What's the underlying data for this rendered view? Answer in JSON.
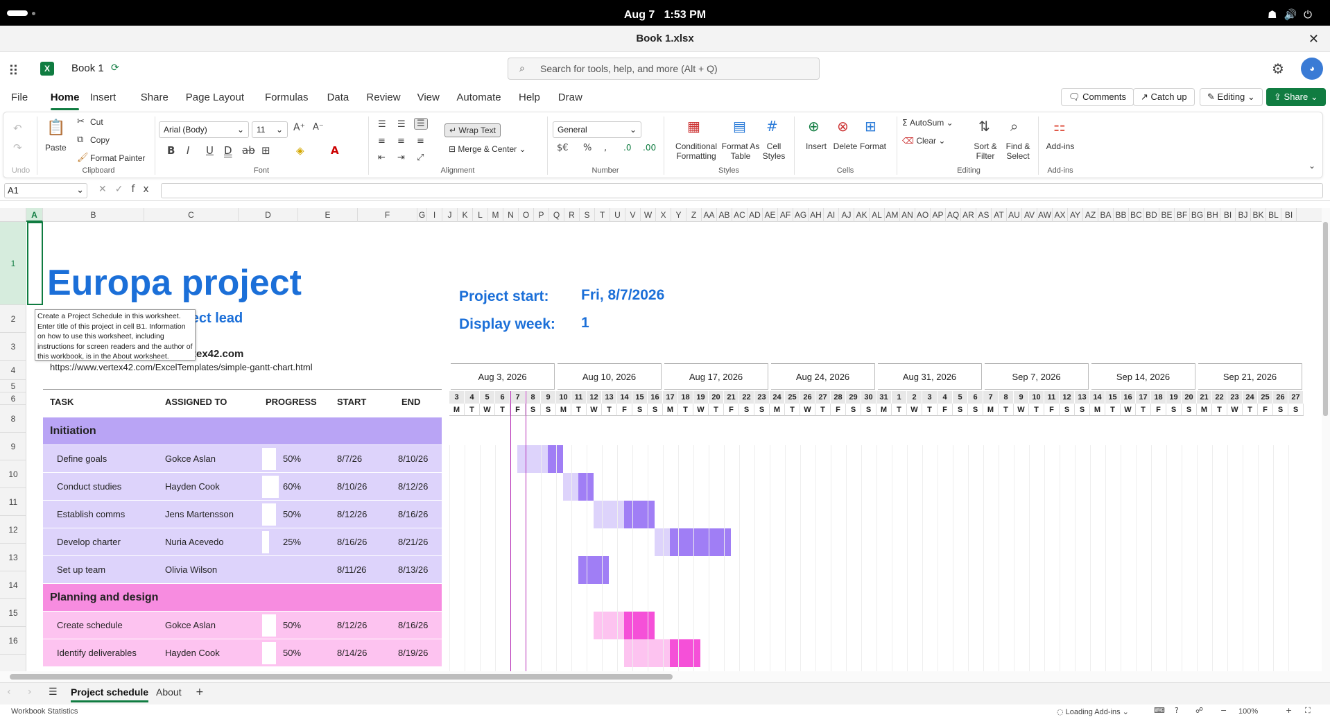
{
  "system": {
    "date": "Aug 7",
    "time": "1:53 PM"
  },
  "window": {
    "title": "Book 1.xlsx"
  },
  "appbar": {
    "book_name": "Book 1",
    "search_placeholder": "Search for tools, help, and more (Alt + Q)"
  },
  "menu": [
    "File",
    "Home",
    "Insert",
    "Share",
    "Page Layout",
    "Formulas",
    "Data",
    "Review",
    "View",
    "Automate",
    "Help",
    "Draw"
  ],
  "menu_active": "Home",
  "actions": {
    "comments": "Comments",
    "catchup": "Catch up",
    "editing": "Editing",
    "share": "Share"
  },
  "ribbon": {
    "undo": "Undo",
    "paste": "Paste",
    "cut": "Cut",
    "copy": "Copy",
    "format_painter": "Format Painter",
    "clipboard": "Clipboard",
    "font_name": "Arial (Body)",
    "font_size": "11",
    "font": "Font",
    "wrap_text": "Wrap Text",
    "merge_center": "Merge & Center",
    "alignment": "Alignment",
    "number_format": "General",
    "number": "Number",
    "cond_fmt_1": "Conditional",
    "cond_fmt_2": "Formatting",
    "fmt_table_1": "Format As",
    "fmt_table_2": "Table",
    "cell_styles_1": "Cell",
    "cell_styles_2": "Styles",
    "styles": "Styles",
    "insert": "Insert",
    "delete": "Delete",
    "format": "Format",
    "cells": "Cells",
    "autosum": "AutoSum",
    "clear": "Clear",
    "sort_1": "Sort &",
    "sort_2": "Filter",
    "find_1": "Find &",
    "find_2": "Select",
    "editing": "Editing",
    "addins": "Add-ins",
    "addins_group": "Add-ins"
  },
  "formula_bar": {
    "name_box": "A1",
    "formula": ""
  },
  "columns": [
    "A",
    "B",
    "C",
    "D",
    "E",
    "F",
    "G",
    "I",
    "J",
    "K",
    "L",
    "M",
    "N",
    "O",
    "P",
    "Q",
    "R",
    "S",
    "T",
    "U",
    "V",
    "W",
    "X",
    "Y",
    "Z",
    "AA",
    "AB",
    "AC",
    "AD",
    "AE",
    "AF",
    "AG",
    "AH",
    "AI",
    "AJ",
    "AK",
    "AL",
    "AM",
    "AN",
    "AO",
    "AP",
    "AQ",
    "AR",
    "AS",
    "AT",
    "AU",
    "AV",
    "AW",
    "AX",
    "AY",
    "AZ",
    "BA",
    "BB",
    "BC",
    "BD",
    "BE",
    "BF",
    "BG",
    "BH",
    "BI",
    "BJ",
    "BK",
    "BL",
    "BI"
  ],
  "rows": [
    "1",
    "2",
    "3",
    "4",
    "5",
    "6",
    "8",
    "9",
    "10",
    "11",
    "12",
    "13",
    "14",
    "15",
    "16"
  ],
  "sheet": {
    "title": "Europa project",
    "lead": "oject lead",
    "company": "tex42.com",
    "url": "https://www.vertex42.com/ExcelTemplates/simple-gantt-chart.html",
    "tooltip": "Create a Project Schedule in this worksheet. Enter title of this project in cell B1. Information on how to use this worksheet, including instructions for screen readers and the author of this workbook, is in the About worksheet.",
    "project_start_label": "Project start:",
    "project_start": "Fri, 8/7/2026",
    "display_week_label": "Display week:",
    "display_week": "1",
    "headers": {
      "task": "TASK",
      "assigned": "ASSIGNED TO",
      "progress": "PROGRESS",
      "start": "START",
      "end": "END"
    }
  },
  "tasks": [
    {
      "type": "section",
      "name": "Initiation",
      "color": "#b9a4f5",
      "light": "#ddd3fb",
      "bar": "#a07ef5",
      "barlight": "#ddd3fb"
    },
    {
      "type": "task",
      "name": "Define goals",
      "assigned": "Gokce Aslan",
      "progress": "50%",
      "pct": 50,
      "start": "8/7/26",
      "end": "8/10/26",
      "s": 4,
      "e": 7,
      "color": "#ddd3fb"
    },
    {
      "type": "task",
      "name": "Conduct studies",
      "assigned": "Hayden Cook",
      "progress": "60%",
      "pct": 60,
      "start": "8/10/26",
      "end": "8/12/26",
      "s": 7,
      "e": 9,
      "color": "#ddd3fb"
    },
    {
      "type": "task",
      "name": "Establish comms",
      "assigned": "Jens Martensson",
      "progress": "50%",
      "pct": 50,
      "start": "8/12/26",
      "end": "8/16/26",
      "s": 9,
      "e": 13,
      "color": "#ddd3fb"
    },
    {
      "type": "task",
      "name": "Develop charter",
      "assigned": "Nuria Acevedo",
      "progress": "25%",
      "pct": 25,
      "start": "8/16/26",
      "end": "8/21/26",
      "s": 13,
      "e": 18,
      "color": "#ddd3fb"
    },
    {
      "type": "task",
      "name": "Set up team",
      "assigned": "Olivia Wilson",
      "progress": "",
      "pct": 100,
      "start": "8/11/26",
      "end": "8/13/26",
      "s": 8,
      "e": 10,
      "color": "#ddd3fb"
    },
    {
      "type": "section",
      "name": "Planning and design",
      "color": "#f78ce0",
      "light": "#fdc3f0",
      "bar": "#f550d8",
      "barlight": "#fdc3f0"
    },
    {
      "type": "task",
      "name": "Create schedule",
      "assigned": "Gokce Aslan",
      "progress": "50%",
      "pct": 50,
      "start": "8/12/26",
      "end": "8/16/26",
      "s": 9,
      "e": 13,
      "color": "#fdc3f0"
    },
    {
      "type": "task",
      "name": "Identify deliverables",
      "assigned": "Hayden Cook",
      "progress": "50%",
      "pct": 50,
      "start": "8/14/26",
      "end": "8/19/26",
      "s": 11,
      "e": 16,
      "color": "#fdc3f0"
    }
  ],
  "weeks": [
    "Aug 3, 2026",
    "Aug 10, 2026",
    "Aug 17, 2026",
    "Aug 24, 2026",
    "Aug 31, 2026",
    "Sep 7, 2026",
    "Sep 14, 2026",
    "Sep 21, 2026"
  ],
  "day_numbers": [
    "3",
    "4",
    "5",
    "6",
    "7",
    "8",
    "9",
    "10",
    "11",
    "12",
    "13",
    "14",
    "15",
    "16",
    "17",
    "18",
    "19",
    "20",
    "21",
    "22",
    "23",
    "24",
    "25",
    "26",
    "27",
    "28",
    "29",
    "30",
    "31",
    "1",
    "2",
    "3",
    "4",
    "5",
    "6",
    "7",
    "8",
    "9",
    "10",
    "11",
    "12",
    "13",
    "14",
    "15",
    "16",
    "17",
    "18",
    "19",
    "20",
    "21",
    "22",
    "23",
    "24",
    "25",
    "26",
    "27"
  ],
  "day_letters": [
    "M",
    "T",
    "W",
    "T",
    "F",
    "S",
    "S"
  ],
  "sheet_tabs": [
    "Project schedule",
    "About"
  ],
  "status": {
    "stats": "Workbook Statistics",
    "addins": "Loading Add-ins",
    "zoom": "100%"
  }
}
